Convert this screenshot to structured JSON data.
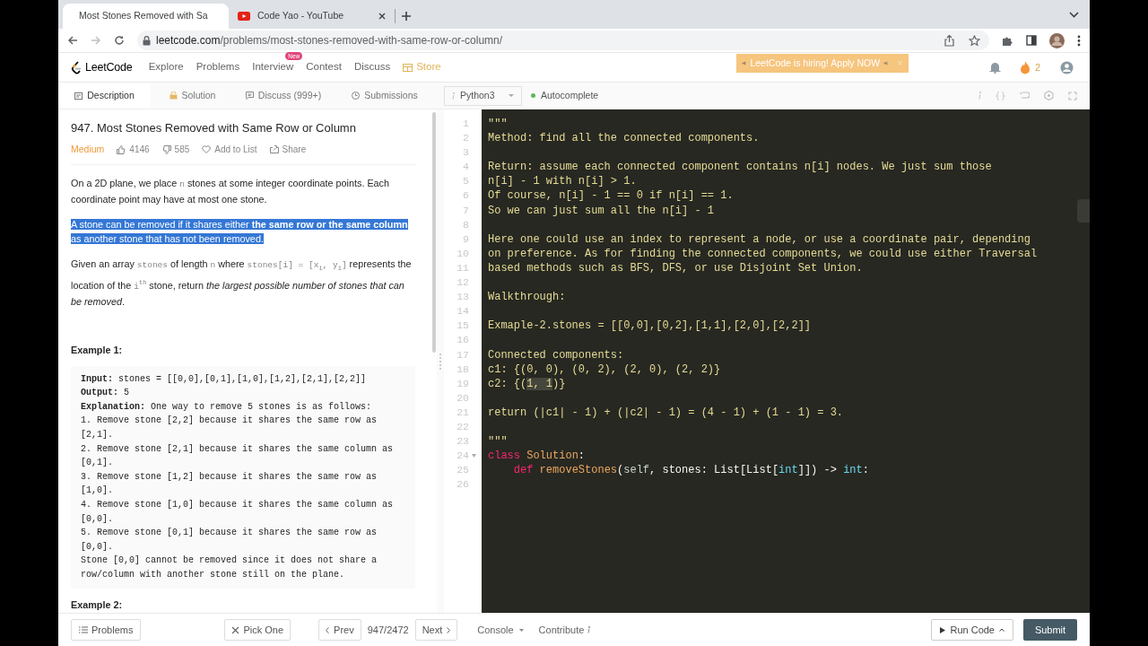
{
  "browser": {
    "tabs": [
      {
        "title": "Most Stones Removed with Sa",
        "selected": true
      },
      {
        "title": "Code Yao - YouTube",
        "selected": false
      }
    ],
    "url": {
      "host": "leetcode.com",
      "path": "/problems/most-stones-removed-with-same-row-or-column/"
    }
  },
  "nav": {
    "logo": "LeetCode",
    "links": [
      {
        "label": "Explore"
      },
      {
        "label": "Problems"
      },
      {
        "label": "Interview",
        "badge": "New"
      },
      {
        "label": "Contest"
      },
      {
        "label": "Discuss"
      },
      {
        "label": "Store",
        "kind": "store"
      }
    ],
    "banner": {
      "text": "LeetCode is hiring! Apply NOW",
      "close": "×"
    },
    "streak": "2"
  },
  "panel_tabs": [
    {
      "label": "Description",
      "selected": true
    },
    {
      "label": "Solution",
      "selected": false
    },
    {
      "label": "Discuss (999+)",
      "selected": false
    },
    {
      "label": "Submissions",
      "selected": false
    }
  ],
  "editor_toolbar": {
    "language": "Python3",
    "autocomplete": {
      "label": "Autocomplete",
      "on": true
    }
  },
  "problem": {
    "title": "947. Most Stones Removed with Same Row or Column",
    "difficulty": "Medium",
    "likes": "4146",
    "dislikes": "585",
    "add_to_list": "Add to List",
    "share": "Share",
    "paragraphs": [
      {
        "selected": false,
        "segments": [
          {
            "kind": "text",
            "text": "On a 2D plane, we place "
          },
          {
            "kind": "code",
            "text": "n"
          },
          {
            "kind": "text",
            "text": " stones at some integer coordinate points. Each coordinate point may have at most one stone."
          }
        ]
      },
      {
        "selected": true,
        "segments": [
          {
            "kind": "text",
            "text": "A stone can be removed if it shares either "
          },
          {
            "kind": "bold",
            "text": "the same row or the same column"
          },
          {
            "kind": "text",
            "text": " as another stone that has not been removed."
          }
        ]
      },
      {
        "selected": false,
        "segments": [
          {
            "kind": "text",
            "text": "Given an array "
          },
          {
            "kind": "code",
            "text": "stones"
          },
          {
            "kind": "text",
            "text": " of length "
          },
          {
            "kind": "code",
            "text": "n"
          },
          {
            "kind": "text",
            "text": " where "
          },
          {
            "kind": "code",
            "text": "stones[i] = [x"
          },
          {
            "kind": "sub",
            "text": "i"
          },
          {
            "kind": "code",
            "text": ", y"
          },
          {
            "kind": "sub",
            "text": "i"
          },
          {
            "kind": "code",
            "text": "]"
          },
          {
            "kind": "text",
            "text": " represents the location of the "
          },
          {
            "kind": "code",
            "text": "i"
          },
          {
            "kind": "sup",
            "text": "th"
          },
          {
            "kind": "text",
            "text": " stone, return "
          },
          {
            "kind": "italic",
            "text": "the largest possible number of stones that can be removed"
          },
          {
            "kind": "text",
            "text": "."
          }
        ]
      }
    ],
    "examples": [
      {
        "heading": "Example 1:",
        "lines": [
          {
            "label": "Input:",
            "text": " stones = [[0,0],[0,1],[1,0],[1,2],[2,1],[2,2]]"
          },
          {
            "label": "Output:",
            "text": " 5"
          },
          {
            "label": "Explanation:",
            "text": " One way to remove 5 stones is as follows:"
          },
          {
            "text": "1. Remove stone [2,2] because it shares the same row as [2,1]."
          },
          {
            "text": "2. Remove stone [2,1] because it shares the same column as [0,1]."
          },
          {
            "text": "3. Remove stone [1,2] because it shares the same row as [1,0]."
          },
          {
            "text": "4. Remove stone [1,0] because it shares the same column as [0,0]."
          },
          {
            "text": "5. Remove stone [0,1] because it shares the same row as [0,0]."
          },
          {
            "text": "Stone [0,0] cannot be removed since it does not share a row/column with another stone still on the plane."
          }
        ]
      },
      {
        "heading": "Example 2:"
      }
    ]
  },
  "code_lines": [
    {
      "number": "1",
      "segments": [
        {
          "kind": "doc",
          "text": "\"\"\""
        }
      ]
    },
    {
      "number": "2",
      "segments": [
        {
          "kind": "doc",
          "text": "Method: find all the connected components."
        }
      ]
    },
    {
      "number": "3"
    },
    {
      "number": "4",
      "segments": [
        {
          "kind": "doc",
          "text": "Return: assume each connected component contains n[i] nodes. We just sum those"
        }
      ]
    },
    {
      "number": "5",
      "segments": [
        {
          "kind": "doc",
          "text": "n[i] - 1 with n[i] > 1."
        }
      ]
    },
    {
      "number": "6",
      "segments": [
        {
          "kind": "doc",
          "text": "Of course, n[i] - 1 == 0 if n[i] == 1."
        }
      ]
    },
    {
      "number": "7",
      "segments": [
        {
          "kind": "doc",
          "text": "So we can just sum all the n[i] - 1"
        }
      ]
    },
    {
      "number": "8"
    },
    {
      "number": "9",
      "segments": [
        {
          "kind": "doc",
          "text": "Here one could use an index to represent a node, or use a coordinate pair, depending"
        }
      ]
    },
    {
      "number": "10",
      "segments": [
        {
          "kind": "doc",
          "text": "on preference. As for finding the connected components, we could use either Traversal"
        }
      ]
    },
    {
      "number": "11",
      "segments": [
        {
          "kind": "doc",
          "text": "based methods such as BFS, DFS, or use Disjoint Set Union."
        }
      ]
    },
    {
      "number": "12"
    },
    {
      "number": "13",
      "segments": [
        {
          "kind": "doc",
          "text": "Walkthrough:"
        }
      ]
    },
    {
      "number": "14"
    },
    {
      "number": "15",
      "segments": [
        {
          "kind": "doc",
          "text": "Exmaple-2.stones = [[0,0],[0,2],[1,1],[2,0],[2,2]]"
        }
      ]
    },
    {
      "number": "16"
    },
    {
      "number": "17",
      "segments": [
        {
          "kind": "doc",
          "text": "Connected components:"
        }
      ]
    },
    {
      "number": "18",
      "segments": [
        {
          "kind": "doc",
          "text": "c1: {(0, 0), (0, 2), (2, 0), (2, 2)}"
        }
      ]
    },
    {
      "number": "19",
      "segments": [
        {
          "kind": "doc",
          "text": "c2: {("
        },
        {
          "kind": "match",
          "text": "1, 1"
        },
        {
          "kind": "doc",
          "text": ")}"
        }
      ]
    },
    {
      "number": "20"
    },
    {
      "number": "21",
      "segments": [
        {
          "kind": "doc",
          "text": "return (|c1| - 1) + (|c2| - 1) = (4 - 1) + (1 - 1) = 3."
        }
      ]
    },
    {
      "number": "22"
    },
    {
      "number": "23",
      "segments": [
        {
          "kind": "doc",
          "text": "\"\"\""
        }
      ]
    },
    {
      "number": "24",
      "fold": true,
      "segments": [
        {
          "kind": "keyword",
          "text": "class"
        },
        {
          "kind": "name",
          "text": " Solution"
        },
        {
          "kind": "plain",
          "text": ":"
        }
      ]
    },
    {
      "number": "25",
      "segments": [
        {
          "kind": "keyword",
          "text": "    def"
        },
        {
          "kind": "name",
          "text": " removeStones"
        },
        {
          "kind": "plain",
          "text": "("
        },
        {
          "kind": "param",
          "text": "self"
        },
        {
          "kind": "plain",
          "text": ", stones: List[List["
        },
        {
          "kind": "type",
          "text": "int"
        },
        {
          "kind": "plain",
          "text": "]]) -> "
        },
        {
          "kind": "type",
          "text": "int"
        },
        {
          "kind": "plain",
          "text": ":"
        }
      ]
    },
    {
      "number": "26"
    }
  ],
  "footer": {
    "problems": "Problems",
    "pick_one": "Pick One",
    "prev": "Prev",
    "counter": "947/2472",
    "next": "Next",
    "console": "Console",
    "contribute": "Contribute",
    "run_code": "Run Code",
    "submit": "Submit"
  }
}
